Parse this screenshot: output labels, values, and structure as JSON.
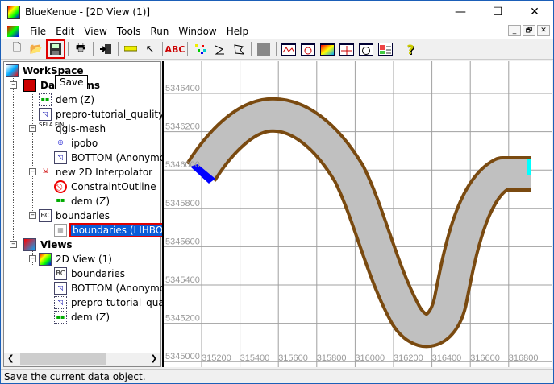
{
  "window": {
    "title": "BlueKenue - [2D View (1)]",
    "minimize": "—",
    "maximize": "☐",
    "close": "✕"
  },
  "menu": [
    "File",
    "Edit",
    "View",
    "Tools",
    "Run",
    "Window",
    "Help"
  ],
  "mdi": [
    "_",
    "🗗",
    "✕"
  ],
  "toolbar": {
    "tooltip": "Save",
    "buttons": [
      "new",
      "open",
      "save",
      "print",
      "import",
      "measure",
      "query",
      "label",
      "points",
      "line",
      "polygon",
      "grey",
      "profile",
      "mesh",
      "colour",
      "cross",
      "radar",
      "legend",
      "help"
    ]
  },
  "tree": {
    "workspace": "WorkSpace",
    "data_items": "Data Items",
    "dem1": "dem (Z)",
    "prepro1": "prepro-tutorial_quality-m",
    "qgis": "qgis-mesh",
    "ipobo": "ipobo",
    "bottom1": "BOTTOM (Anonymou",
    "interp": "new 2D Interpolator",
    "constraint": "ConstraintOutline",
    "dem2": "dem (Z)",
    "boundaries": "boundaries",
    "lihbor": "boundaries (LIHBOR)",
    "views": "Views",
    "view2d": "2D View (1)",
    "v_boundaries": "boundaries",
    "v_bottom": "BOTTOM (Anonymou",
    "v_prepro": "prepro-tutorial_qualit",
    "v_dem": "dem (Z)"
  },
  "view": {
    "x_ticks": [
      "315200",
      "315400",
      "315600",
      "315800",
      "316000",
      "316200",
      "316400",
      "316600",
      "316800"
    ],
    "y_ticks": [
      "5346400",
      "5346200",
      "5346000",
      "5345800",
      "5345600",
      "5345400",
      "5345200",
      "5345000"
    ],
    "colors": {
      "grid": "#a0a0a0",
      "mesh": "#c0c0c0",
      "boundary": "#7a4a10",
      "open_left": "#0000ff",
      "open_right": "#00ffff"
    }
  },
  "status": "Save the current data object."
}
